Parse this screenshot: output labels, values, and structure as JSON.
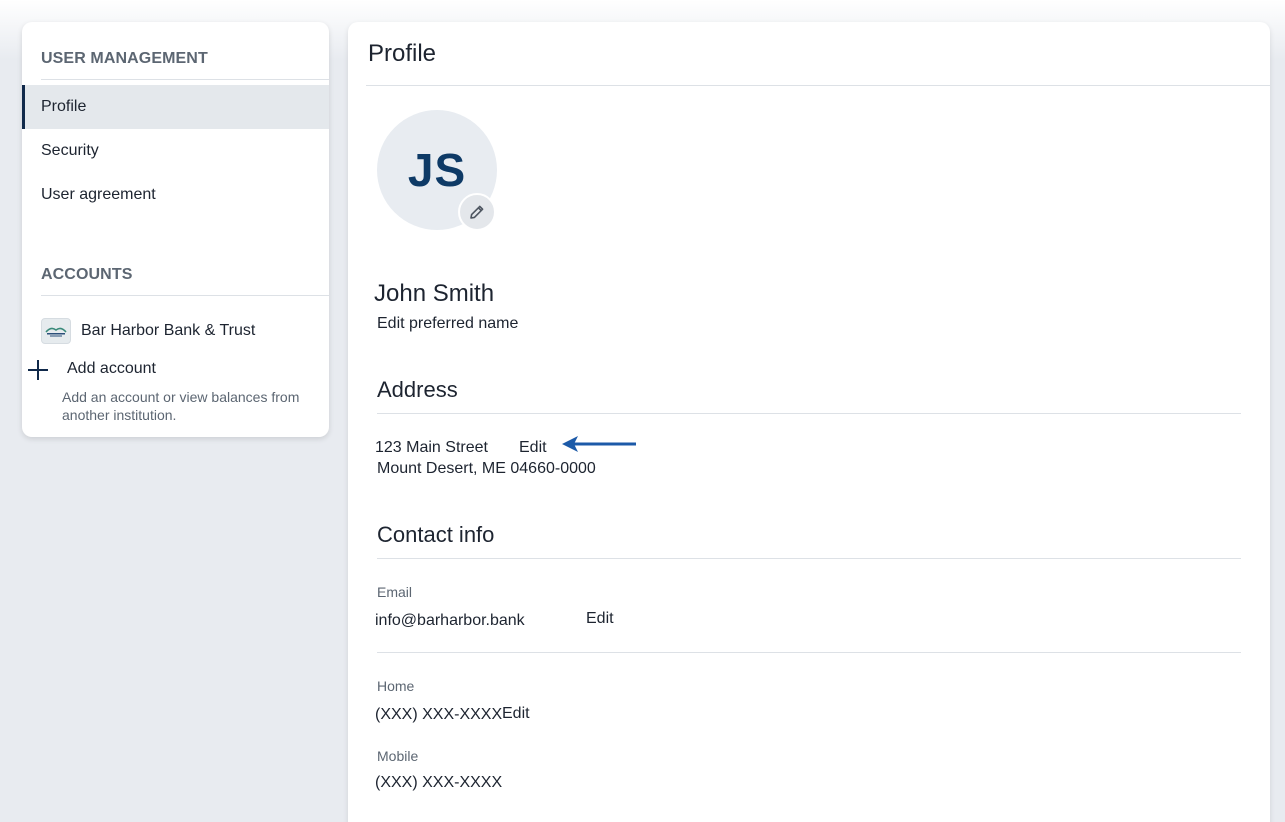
{
  "sidebar": {
    "user_management_heading": "USER MANAGEMENT",
    "items": [
      {
        "label": "Profile",
        "active": true
      },
      {
        "label": "Security",
        "active": false
      },
      {
        "label": "User agreement",
        "active": false
      }
    ],
    "accounts_heading": "ACCOUNTS",
    "bank": {
      "name": "Bar Harbor Bank & Trust",
      "logo_icon": "bank-logo-icon"
    },
    "add_account": {
      "label": "Add account",
      "description": "Add an account or view balances from another institution.",
      "icon": "plus-icon"
    }
  },
  "main": {
    "title": "Profile",
    "avatar": {
      "initials": "JS",
      "edit_icon": "pencil-icon"
    },
    "name": "John Smith",
    "edit_preferred_name": "Edit preferred name",
    "address": {
      "heading": "Address",
      "line1": "123 Main Street",
      "line2": "Mount Desert, ME 04660-0000",
      "edit_label": "Edit"
    },
    "contact": {
      "heading": "Contact info",
      "email_label": "Email",
      "email_value": "info@barharbor.bank",
      "email_edit": "Edit",
      "home_label": "Home",
      "home_value": "(XXX) XXX-XXXX",
      "home_edit": "Edit",
      "mobile_label": "Mobile",
      "mobile_value": "(XXX) XXX-XXXX"
    }
  },
  "colors": {
    "page_bg": "#e8ebf0",
    "accent_navy": "#10294a",
    "initials": "#0e3a66",
    "arrow": "#1c5aa8"
  }
}
